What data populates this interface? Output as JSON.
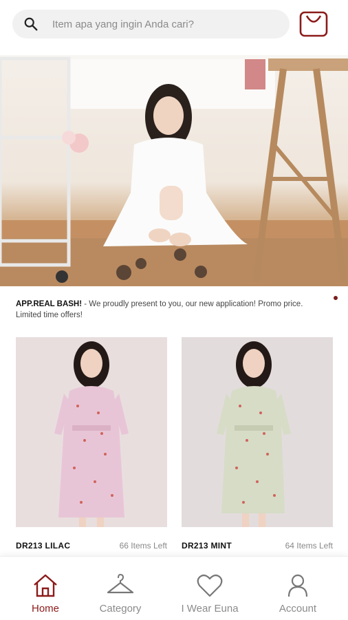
{
  "search": {
    "placeholder": "Item apa yang ingin Anda cari?"
  },
  "banner": {
    "title": "APP.REAL BASH!",
    "text": " - We proudly present to you, our new application! Promo price. Limited time offers!"
  },
  "products": [
    {
      "name": "DR213 LILAC",
      "stock": "66 Items Left"
    },
    {
      "name": "DR213 MINT",
      "stock": "64 Items Left"
    }
  ],
  "nav": [
    {
      "label": "Home",
      "icon": "home-icon",
      "active": true
    },
    {
      "label": "Category",
      "icon": "hanger-icon",
      "active": false
    },
    {
      "label": "I Wear Euna",
      "icon": "heart-icon",
      "active": false
    },
    {
      "label": "Account",
      "icon": "user-icon",
      "active": false
    }
  ],
  "colors": {
    "accent": "#8b1a1a",
    "nav_inactive": "#8a8a8a"
  }
}
